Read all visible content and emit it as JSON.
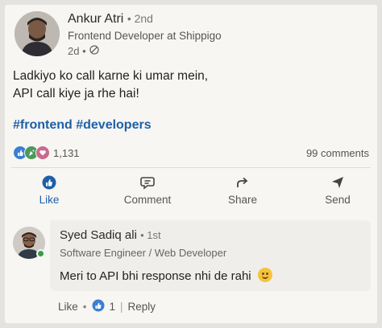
{
  "post": {
    "author_name": "Ankur Atri",
    "author_degree": "• 2nd",
    "author_title": "Frontend Developer at Shippigo",
    "time": "2d •",
    "text_line1": "Ladkiyo ko call karne ki umar mein,",
    "text_line2": "API call kiye ja rhe hai!",
    "hashtags": "#frontend #developers",
    "reaction_count": "1,131",
    "comments_count": "99 comments"
  },
  "actions": {
    "like": "Like",
    "comment": "Comment",
    "share": "Share",
    "send": "Send"
  },
  "comment": {
    "name": "Syed Sadiq ali",
    "degree": "• 1st",
    "title": "Software Engineer / Web Developer",
    "text": "Meri to API bhi response nhi de rahi",
    "like_label": "Like",
    "like_count": "1",
    "reply_label": "Reply"
  },
  "colors": {
    "link_blue": "#1e5fa8",
    "card_bg": "#f7f6f3",
    "comment_bg": "#efeeeb"
  }
}
